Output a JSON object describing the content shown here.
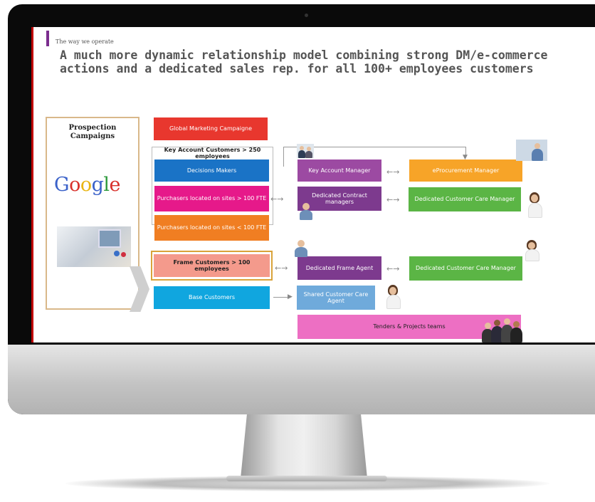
{
  "slide": {
    "kicker": "The way we operate",
    "title": "A much more dynamic relationship model combining strong DM/e-commerce actions and a dedicated sales rep. for all 100+ employees customers"
  },
  "prospection": {
    "title": "Prospection Campaigns",
    "google_letters": [
      {
        "ch": "G",
        "color": "#3b62c9"
      },
      {
        "ch": "o",
        "color": "#d8302a"
      },
      {
        "ch": "o",
        "color": "#e9b512"
      },
      {
        "ch": "g",
        "color": "#3b62c9"
      },
      {
        "ch": "l",
        "color": "#2e9a3c"
      },
      {
        "ch": "e",
        "color": "#d8302a"
      }
    ]
  },
  "segments": {
    "global_marketing": "Global Marketing Campaigne",
    "key_account_label": "Key Account Customers > 250 employees",
    "decisions_makers": "Decisions Makers",
    "purchasers_large": "Purchasers located on sites > 100 FTE",
    "purchasers_small": "Purchasers located on sites < 100 FTE",
    "frame_customers": "Frame Customers > 100 employees",
    "base_customers": "Base Customers"
  },
  "roles": {
    "key_account_manager": "Key Account Manager",
    "dedicated_contract_managers": "Dedicated Contract managers",
    "eprocurement_manager": "eProcurement Manager",
    "dedicated_ccm_1": "Dedicated Customer Care Manager",
    "dedicated_frame_agent": "Dedicated Frame Agent",
    "dedicated_ccm_2": "Dedicated Customer Care Manager",
    "shared_customer_care_agent": "Shared Customer Care Agent",
    "tenders_projects": "Tenders & Projects teams"
  },
  "colors": {
    "red": "#e8372e",
    "blue": "#1a73c6",
    "magenta": "#e6198a",
    "orange": "#f07e22",
    "salmon": "#f49a8c",
    "cyan": "#10a6df",
    "purple": "#9c4aa2",
    "purple_dark": "#7d3a8e",
    "amber": "#f7a428",
    "green": "#5bb545",
    "light_blue": "#6faadb",
    "pink": "#ed6fc3"
  }
}
